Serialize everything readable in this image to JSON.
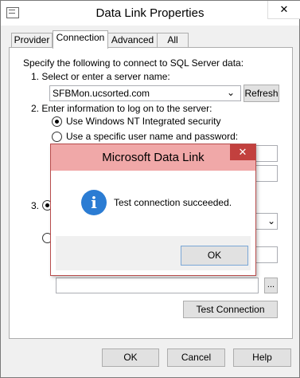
{
  "window": {
    "title": "Data Link Properties",
    "close_glyph": "✕"
  },
  "tabs": [
    {
      "label": "Provider"
    },
    {
      "label": "Connection"
    },
    {
      "label": "Advanced"
    },
    {
      "label": "All"
    }
  ],
  "connection": {
    "intro": "Specify the following to connect to SQL Server data:",
    "step1_label": "1. Select or enter a server name:",
    "server_value": "SFBMon.ucsorted.com",
    "refresh_label": "Refresh",
    "step2_label": "2. Enter information to log on to the server:",
    "option_nt_security": "Use Windows NT Integrated security",
    "option_specific_user": "Use a specific user name and password:",
    "step3_label": "3.",
    "ellipsis_label": "...",
    "test_connection_label": "Test Connection"
  },
  "footer": {
    "ok_label": "OK",
    "cancel_label": "Cancel",
    "help_label": "Help"
  },
  "dialog": {
    "title": "Microsoft Data Link",
    "close_glyph": "✕",
    "icon_glyph": "i",
    "message": "Test connection succeeded.",
    "ok_label": "OK"
  }
}
